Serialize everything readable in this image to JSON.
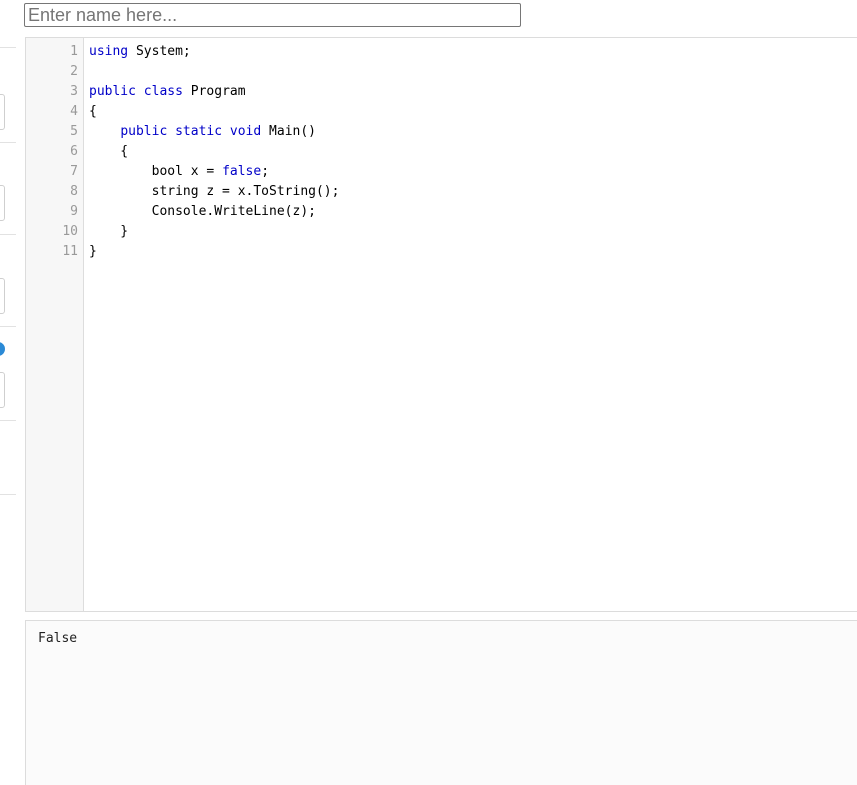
{
  "name_input": {
    "placeholder": "Enter name here...",
    "value": ""
  },
  "editor": {
    "lines": [
      {
        "number": "1",
        "tokens": [
          {
            "t": "using",
            "k": true
          },
          {
            "t": " System;",
            "k": false
          }
        ]
      },
      {
        "number": "2",
        "tokens": []
      },
      {
        "number": "3",
        "tokens": [
          {
            "t": "public",
            "k": true
          },
          {
            "t": " ",
            "k": false
          },
          {
            "t": "class",
            "k": true
          },
          {
            "t": " Program",
            "k": false
          }
        ]
      },
      {
        "number": "4",
        "tokens": [
          {
            "t": "{",
            "k": false
          }
        ]
      },
      {
        "number": "5",
        "tokens": [
          {
            "t": "    ",
            "k": false
          },
          {
            "t": "public",
            "k": true
          },
          {
            "t": " ",
            "k": false
          },
          {
            "t": "static",
            "k": true
          },
          {
            "t": " ",
            "k": false
          },
          {
            "t": "void",
            "k": true
          },
          {
            "t": " Main()",
            "k": false
          }
        ]
      },
      {
        "number": "6",
        "tokens": [
          {
            "t": "    {",
            "k": false
          }
        ]
      },
      {
        "number": "7",
        "tokens": [
          {
            "t": "        bool x = ",
            "k": false
          },
          {
            "t": "false",
            "k": true
          },
          {
            "t": ";",
            "k": false
          }
        ]
      },
      {
        "number": "8",
        "tokens": [
          {
            "t": "        string z = x.ToString();",
            "k": false
          }
        ]
      },
      {
        "number": "9",
        "tokens": [
          {
            "t": "        Console.WriteLine(z);",
            "k": false
          }
        ]
      },
      {
        "number": "10",
        "tokens": [
          {
            "t": "    }",
            "k": false
          }
        ]
      },
      {
        "number": "11",
        "tokens": [
          {
            "t": "}",
            "k": false
          }
        ]
      }
    ]
  },
  "output": {
    "text": "False"
  }
}
